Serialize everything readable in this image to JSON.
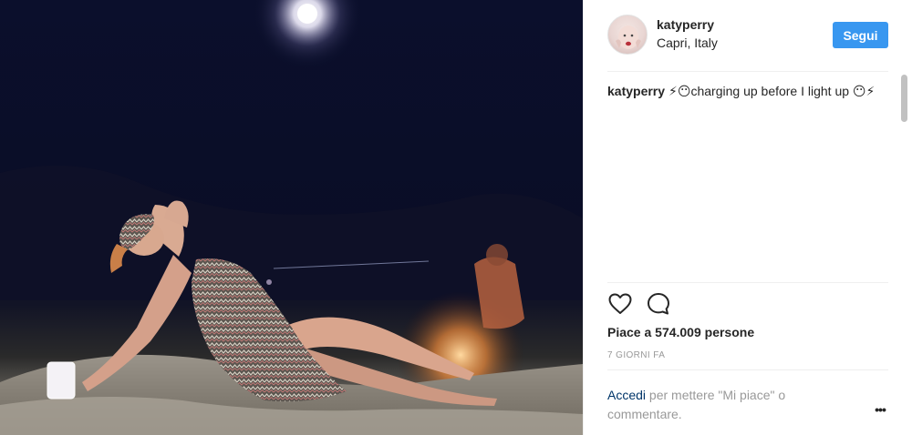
{
  "post": {
    "photo_alt": "Post photo"
  },
  "header": {
    "username": "katyperry",
    "location": "Capri, Italy",
    "follow_label": "Segui"
  },
  "caption": {
    "username": "katyperry",
    "text": "⚡😶charging up before I light up 😶⚡"
  },
  "actions": {
    "like_icon": "heart-outline-icon",
    "comment_icon": "comment-bubble-icon"
  },
  "likes": {
    "text": "Piace a 574.009 persone"
  },
  "timestamp": {
    "text": "7 GIORNI FA"
  },
  "login_prompt": {
    "link_label": "Accedi",
    "rest_text": " per mettere \"Mi piace\" o commentare."
  },
  "more_options": {
    "label": "•••"
  },
  "colors": {
    "follow_button": "#3897f0",
    "link": "#003569",
    "secondary_text": "#999999",
    "divider": "#efefef"
  }
}
